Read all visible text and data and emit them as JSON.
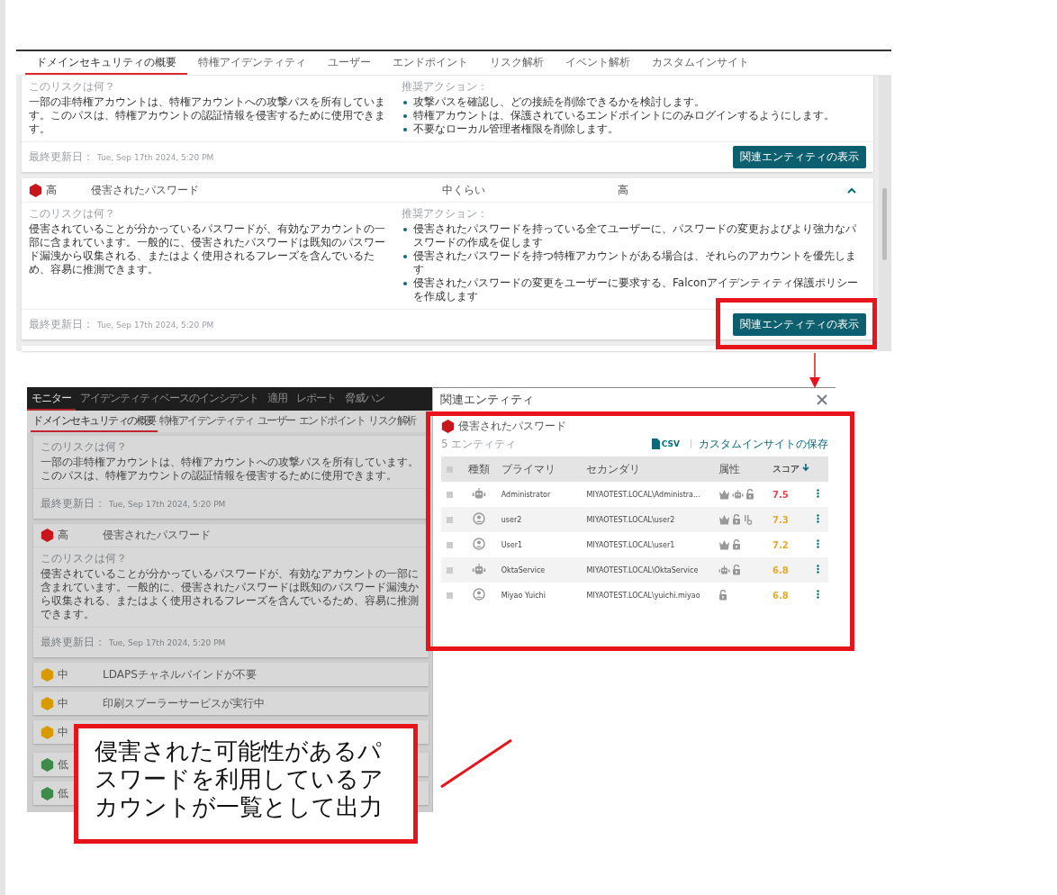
{
  "top_screen": {
    "tabs": [
      {
        "label": "ドメインセキュリティの概要",
        "selected": true
      },
      {
        "label": "特権アイデンティティ",
        "selected": false
      },
      {
        "label": "ユーザー",
        "selected": false
      },
      {
        "label": "エンドポイント",
        "selected": false
      },
      {
        "label": "リスク解析",
        "selected": false
      },
      {
        "label": "イベント解析",
        "selected": false
      },
      {
        "label": "カスタムインサイト",
        "selected": false
      }
    ],
    "cards": [
      {
        "what_label": "このリスクは何？",
        "description": "一部の非特権アカウントは、特権アカウントへの攻撃パスを所有しています。このパスは、特権アカウントの認証情報を侵害するために使用できます。",
        "actions_label": "推奨アクション：",
        "actions": [
          "攻撃パスを確認し、どの接続を削除できるかを検討します。",
          "特権アカウントは、保護されているエンドポイントにのみログインするようにします。",
          "不要なローカル管理者権限を削除します。"
        ],
        "updated_label": "最終更新日：",
        "updated": "Tue, Sep 17th 2024, 5:20 PM",
        "button": "関連エンティティの表示",
        "button_highlighted": false
      },
      {
        "header": {
          "color": "#c8161d",
          "severity_label": "高",
          "title": "侵害されたパスワード",
          "likelihood": "中くらい",
          "impact": "高",
          "expanded": true
        },
        "what_label": "このリスクは何？",
        "description": "侵害されていることが分かっているパスワードが、有効なアカウントの一部に含まれています。一般的に、侵害されたパスワードは既知のパスワード漏洩から収集される、またはよく使用されるフレーズを含んでいるため、容易に推測できます。",
        "actions_label": "推奨アクション：",
        "actions": [
          "侵害されたパスワードを持っている全てユーザーに、パスワードの変更およびより強力なパスワードの作成を促します",
          "侵害されたパスワードを持つ特権アカウントがある場合は、それらのアカウントを優先します",
          "侵害されたパスワードの変更をユーザーに要求する、Falconアイデンティティ保護ポリシーを作成します"
        ],
        "updated_label": "最終更新日：",
        "updated": "Tue, Sep 17th 2024, 5:20 PM",
        "button": "関連エンティティの表示",
        "button_highlighted": true
      }
    ]
  },
  "bottom_screen": {
    "nav": [
      {
        "label": "モニター",
        "selected": true
      },
      {
        "label": "アイデンティティベースのインシデント",
        "selected": false
      },
      {
        "label": "適用",
        "selected": false
      },
      {
        "label": "レポート",
        "selected": false
      },
      {
        "label": "脅威ハン",
        "selected": false
      }
    ],
    "subtabs": [
      {
        "label": "ドメインセキュリティの概要",
        "selected": true
      },
      {
        "label": "特権アイデンティティ",
        "selected": false
      },
      {
        "label": "ユーザー",
        "selected": false
      },
      {
        "label": "エンドポイント",
        "selected": false
      },
      {
        "label": "リスク解析",
        "selected": false
      }
    ],
    "cards": [
      {
        "what_label": "このリスクは何？",
        "description": "一部の非特権アカウントは、特権アカウントへの攻撃パスを所有しています。このパスは、特権アカウントの認証情報を侵害するために使用できます。",
        "updated_label": "最終更新日：",
        "updated": "Tue, Sep 17th 2024, 5:20 PM"
      },
      {
        "header": {
          "color": "#c8161d",
          "severity_label": "高",
          "title": "侵害されたパスワード"
        },
        "what_label": "このリスクは何？",
        "description": "侵害されていることが分かっているパスワードが、有効なアカウントの一部に含まれています。一般的に、侵害されたパスワードは既知のパスワード漏洩から収集される、またはよく使用されるフレーズを含んでいるため、容易に推測できます。",
        "updated_label": "最終更新日：",
        "updated": "Tue, Sep 17th 2024, 5:20 PM"
      }
    ],
    "risk_rows": [
      {
        "color": "#d99a00",
        "severity_label": "中",
        "title": "LDAPSチャネルバインドが不要"
      },
      {
        "color": "#d99a00",
        "severity_label": "中",
        "title": "印刷スプーラーサービスが実行中"
      },
      {
        "color": "#d99a00",
        "severity_label": "中"
      },
      {
        "color": "#3f8a4a",
        "severity_label": "低"
      },
      {
        "color": "#3f8a4a",
        "severity_label": "低"
      }
    ]
  },
  "drawer": {
    "title": "関連エンティティ",
    "risk": {
      "color": "#c8161d",
      "title": "侵害されたパスワード"
    },
    "count": "5 エンティティ",
    "csv": "CSV",
    "save": "カスタムインサイトの保存",
    "columns": [
      "種類",
      "プライマリ",
      "セカンダリ",
      "属性",
      "スコア"
    ],
    "all_checked": false,
    "rows": [
      {
        "checked": false,
        "kind": "robot",
        "primary": "Administrator",
        "secondary": "MIYAOTEST.LOCAL\\Administra...",
        "attributes": [
          {
            "kind": "crown"
          },
          {
            "kind": "robot"
          },
          {
            "kind": "lock"
          }
        ],
        "score": "7.5",
        "color": "#e8474e"
      },
      {
        "checked": false,
        "kind": "user",
        "primary": "user2",
        "secondary": "MIYAOTEST.LOCAL\\user2",
        "attributes": [
          {
            "kind": "crown"
          },
          {
            "kind": "lock"
          },
          {
            "kind": "key"
          }
        ],
        "score": "7.3",
        "color": "#e8a92a"
      },
      {
        "checked": false,
        "kind": "user",
        "primary": "User1",
        "secondary": "MIYAOTEST.LOCAL\\user1",
        "attributes": [
          {
            "kind": "crown"
          },
          {
            "kind": "lock"
          }
        ],
        "score": "7.2",
        "color": "#e8a92a"
      },
      {
        "checked": false,
        "kind": "robot",
        "primary": "OktaService",
        "secondary": "MIYAOTEST.LOCAL\\OktaService",
        "attributes": [
          {
            "kind": "robot"
          },
          {
            "kind": "lock"
          }
        ],
        "score": "6.8",
        "color": "#e8a92a"
      },
      {
        "checked": false,
        "kind": "user",
        "primary": "Miyao Yuichi",
        "secondary": "MIYAOTEST.LOCAL\\yuichi.miyao",
        "attributes": [
          {
            "kind": "lock"
          }
        ],
        "score": "6.8",
        "color": "#e8a92a"
      }
    ]
  },
  "callout": {
    "text": "侵害された可能性があるパスワードを利用しているアカウントが一覧として出力"
  }
}
